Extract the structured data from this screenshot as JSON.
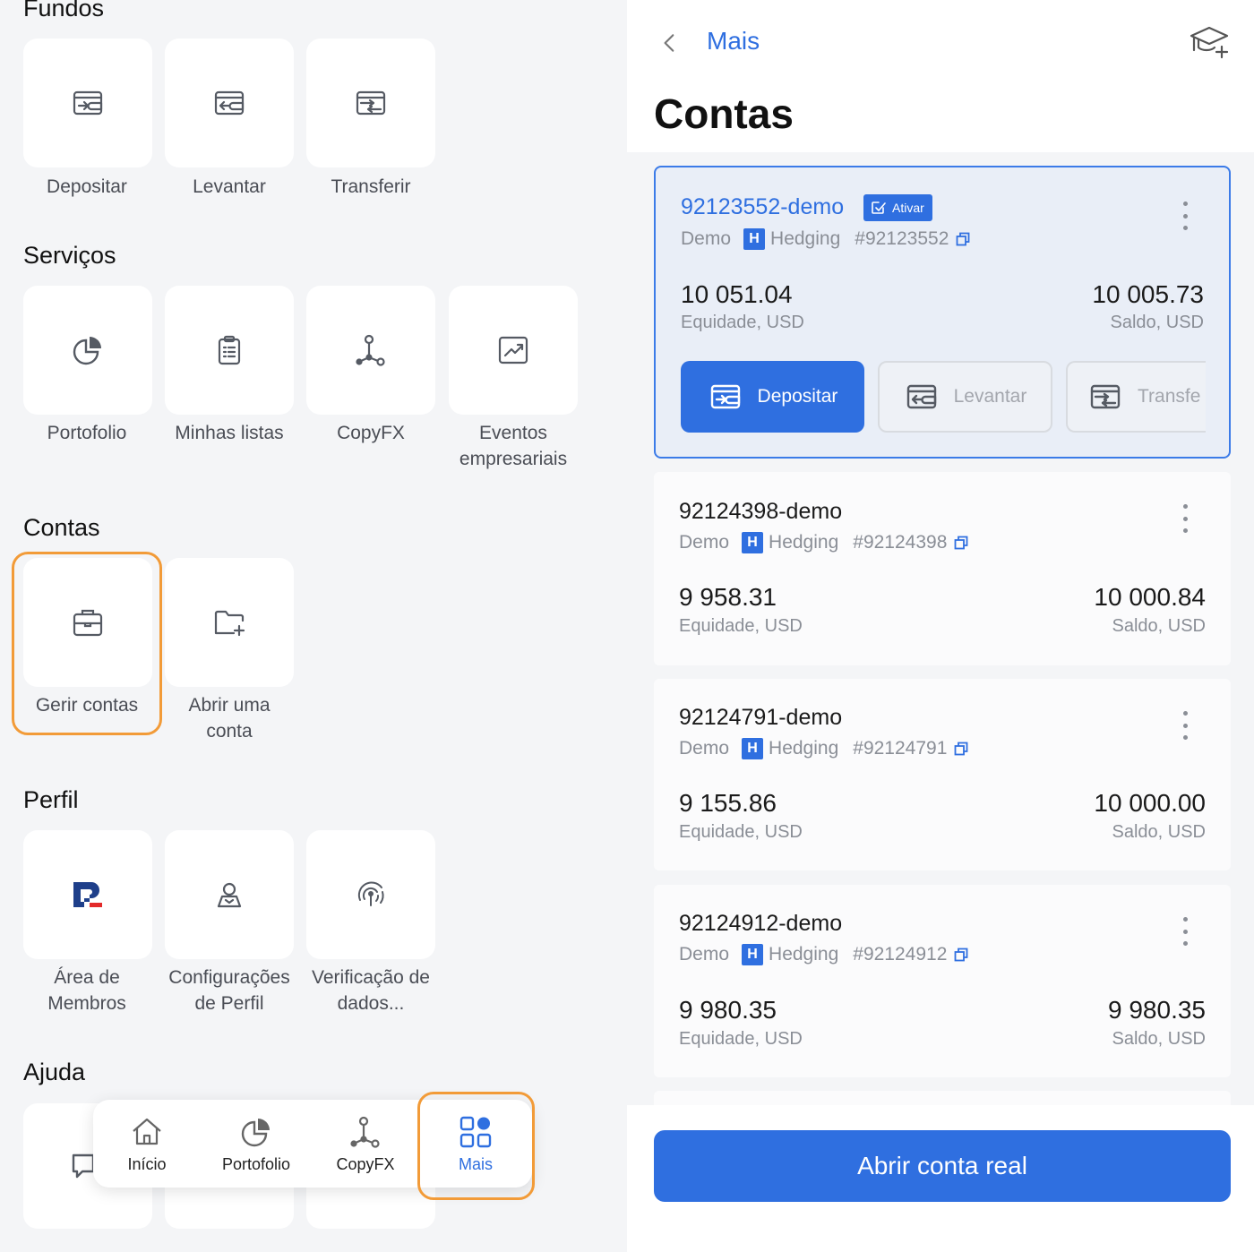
{
  "colors": {
    "accent": "#2f6fe0",
    "highlight": "#f29b38",
    "muted": "#8a8e96"
  },
  "left": {
    "sections": {
      "fundos": "Fundos",
      "servicos": "Serviços",
      "contas": "Contas",
      "perfil": "Perfil",
      "ajuda": "Ajuda"
    },
    "fundos": [
      {
        "label": "Depositar",
        "icon": "deposit-icon"
      },
      {
        "label": "Levantar",
        "icon": "withdraw-icon"
      },
      {
        "label": "Transferir",
        "icon": "transfer-icon"
      }
    ],
    "servicos": [
      {
        "label": "Portofolio",
        "icon": "pie-chart-icon"
      },
      {
        "label": "Minhas listas",
        "icon": "clipboard-list-icon"
      },
      {
        "label": "CopyFX",
        "icon": "copyfx-nodes-icon"
      },
      {
        "label_line1": "Eventos",
        "label_line2": "empresariais",
        "icon": "chart-frame-icon"
      }
    ],
    "contas": [
      {
        "label": "Gerir contas",
        "icon": "briefcase-icon"
      },
      {
        "label_line1": "Abrir uma",
        "label_line2": "conta",
        "icon": "folder-add-icon"
      }
    ],
    "perfil": [
      {
        "label_line1": "Área de",
        "label_line2": "Membros",
        "icon": "roboforex-logo-icon"
      },
      {
        "label_line1": "Configurações",
        "label_line2": "de Perfil",
        "icon": "user-profile-icon"
      },
      {
        "label_line1": "Verificação de",
        "label_line2": "dados...",
        "icon": "fingerprint-icon"
      }
    ],
    "bottom_nav": [
      {
        "label": "Início",
        "icon": "home-icon"
      },
      {
        "label": "Portofolio",
        "icon": "pie-chart-icon"
      },
      {
        "label": "CopyFX",
        "icon": "copyfx-nodes-icon"
      },
      {
        "label": "Mais",
        "icon": "grid-more-icon"
      }
    ]
  },
  "right": {
    "back_label": "Mais",
    "title": "Contas",
    "accounts": [
      {
        "name": "92123552-demo",
        "badge": "Ativar",
        "type": "Demo",
        "h": "H",
        "mode": "Hedging",
        "number": "#92123552",
        "equity": "10 051.04",
        "equity_label": "Equidade, USD",
        "balance": "10 005.73",
        "balance_label": "Saldo, USD",
        "actions": {
          "deposit": "Depositar",
          "withdraw": "Levantar",
          "transfer": "Transfe"
        }
      },
      {
        "name": "92124398-demo",
        "type": "Demo",
        "h": "H",
        "mode": "Hedging",
        "number": "#92124398",
        "equity": "9 958.31",
        "equity_label": "Equidade, USD",
        "balance": "10 000.84",
        "balance_label": "Saldo, USD"
      },
      {
        "name": "92124791-demo",
        "type": "Demo",
        "h": "H",
        "mode": "Hedging",
        "number": "#92124791",
        "equity": "9 155.86",
        "equity_label": "Equidade, USD",
        "balance": "10 000.00",
        "balance_label": "Saldo, USD"
      },
      {
        "name": "92124912-demo",
        "type": "Demo",
        "h": "H",
        "mode": "Hedging",
        "number": "#92124912",
        "equity": "9 980.35",
        "equity_label": "Equidade, USD",
        "balance": "9 980.35",
        "balance_label": "Saldo, USD"
      }
    ],
    "open_real_label": "Abrir conta real"
  }
}
